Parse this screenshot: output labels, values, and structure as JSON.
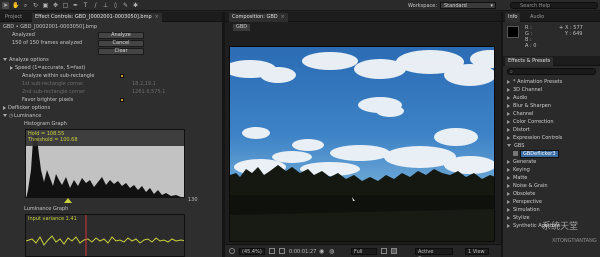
{
  "toolbar": {
    "workspace_label": "Workspace:",
    "workspace_value": "Standard",
    "search_placeholder": "Search Help",
    "tools": [
      "selection-tool",
      "hand-tool",
      "zoom-tool",
      "rotate-tool",
      "camera-tool",
      "pan-behind-tool",
      "mask-tool",
      "pen-tool",
      "type-tool",
      "brush-tool",
      "clone-tool",
      "eraser-tool",
      "roto-brush-tool",
      "puppet-tool"
    ]
  },
  "left_panel": {
    "tab_project": "Project",
    "tab_effect_controls": "Effect Controls: GBD_[0002001-0003050].bmp",
    "layer_path": "GBD • GBD_[0002001-0003050].bmp",
    "status_label": "Analyzed",
    "status_detail": "150 of 150 frames analyzed",
    "btn_analyze": "Analyze",
    "btn_cancel": "Cancel",
    "btn_clear": "Clear",
    "analyze_options": "Analyze options",
    "speed": "Speed (1=accurate, 5=fast)",
    "analyze_within": "Analyze within sub-rectangle",
    "first_corner": "1st sub-rectangle corner",
    "first_corner_val": "18.2,19.1",
    "second_corner": "2nd sub-rectangle corner",
    "second_corner_val": "1261.6,575.1",
    "favor_brighter": "Favor brighter pixels",
    "deflicker": "Deflicker options",
    "luminance": "Luminance",
    "histogram_graph": "Histogram Graph",
    "hist_label_1": "Hold = 108.55",
    "hist_label_2": "Threshold = 100.68",
    "hist_max": "130",
    "luminance_graph": "Luminance Graph",
    "lum_label": "Input variance 1.41"
  },
  "composition": {
    "tab_label": "Composition: GBD",
    "comp_name": "GBD",
    "zoom": "(45.4%)",
    "timecode": "0:00:01:27",
    "resolution": "Full",
    "view": "Active Camera",
    "views": "1 View"
  },
  "info_panel": {
    "tab_info": "Info",
    "tab_audio": "Audio",
    "r": "R :",
    "g": "G :",
    "b": "B :",
    "a": "A : 0",
    "x": "X : 577",
    "y": "Y : 649"
  },
  "effects_presets": {
    "tab": "Effects & Presets",
    "items": [
      "* Animation Presets",
      "3D Channel",
      "Audio",
      "Blur & Sharpen",
      "Channel",
      "Color Correction",
      "Distort",
      "Expression Controls",
      "GBS",
      "GBDeflicker3",
      "Generate",
      "Keying",
      "Matte",
      "Noise & Grain",
      "Obsolete",
      "Perspective",
      "Simulation",
      "Stylize",
      "Synthetic Aperture"
    ]
  },
  "watermark": {
    "main": "系统天堂",
    "sub": "XITONGTIANTANG"
  },
  "colors": {
    "accent_yellow": "#c8d23c",
    "playhead_red": "#d8323c",
    "selected_blue": "#3a6ea5",
    "checkbox_orange": "#c89a3a"
  }
}
